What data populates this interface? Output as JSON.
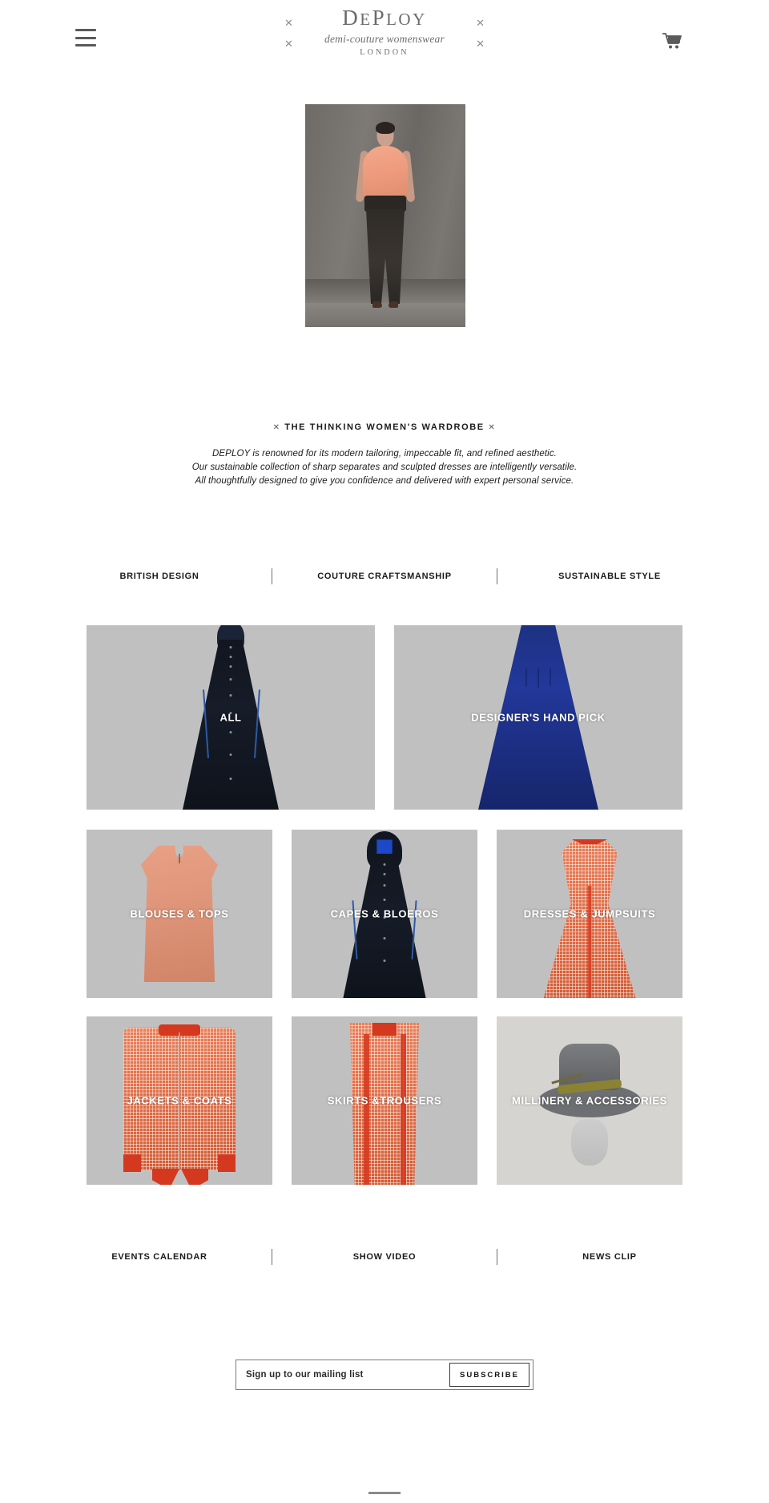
{
  "header": {
    "menu_icon": "hamburger-menu-icon",
    "cart_icon": "shopping-cart-icon",
    "logo": {
      "name": "DePloy",
      "name_display": "DEPLOY",
      "tagline": "demi-couture womenswear",
      "city": "LONDON",
      "decoration": "✕"
    }
  },
  "hero": {
    "alt": "Model wearing peach sleeveless blouse and black high-waisted trousers"
  },
  "intro": {
    "mark_left": "✕",
    "mark_right": "✕",
    "headline": "THE THINKING WOMEN'S WARDROBE",
    "line1": "DEPLOY is renowned for its modern tailoring, impeccable fit, and refined aesthetic.",
    "line2": "Our sustainable collection of sharp separates and sculpted dresses are intelligently versatile.",
    "line3": "All thoughtfully designed to give you confidence and delivered with expert personal service."
  },
  "features": [
    {
      "label": "BRITISH DESIGN"
    },
    {
      "label": "COUTURE CRAFTSMANSHIP"
    },
    {
      "label": "SUSTAINABLE STYLE"
    }
  ],
  "categories": {
    "featured": [
      {
        "label": "ALL",
        "art": "black-cape"
      },
      {
        "label": "DESIGNER'S HAND PICK",
        "art": "blue-gown"
      }
    ],
    "row2": [
      {
        "label": "BLOUSES & TOPS",
        "art": "peach-blouse"
      },
      {
        "label": "CAPES & BLOEROS",
        "art": "black-cape"
      },
      {
        "label": "DRESSES & JUMPSUITS",
        "art": "orange-dress"
      }
    ],
    "row3": [
      {
        "label": "JACKETS & COATS",
        "art": "orange-jacket"
      },
      {
        "label": "SKIRTS &TROUSERS",
        "art": "orange-skirt"
      },
      {
        "label": "MILLINERY & ACCESSORIES",
        "art": "grey-hat"
      }
    ]
  },
  "media": [
    {
      "label": "EVENTS CALENDAR"
    },
    {
      "label": "SHOW VIDEO"
    },
    {
      "label": "NEWS CLIP"
    }
  ],
  "newsletter": {
    "placeholder": "Sign up to our mailing list",
    "value": "",
    "submit_label": "SUBSCRIBE"
  },
  "colors": {
    "tile_background": "#c0c0c0",
    "logo_grey": "#6b6b6b",
    "text_dark": "#1a1a1a",
    "rule_grey": "#8a8a8a"
  }
}
